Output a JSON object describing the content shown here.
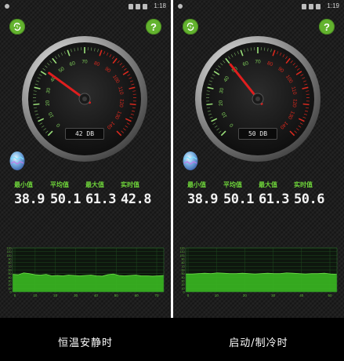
{
  "panels": [
    {
      "status_time": "1:18",
      "refresh_icon": "refresh-bolt-icon",
      "help_label": "?",
      "gauge": {
        "reading": "42 DB",
        "needle_value": 42,
        "scale_max": 140,
        "red_zone_start": 80
      },
      "stats": [
        {
          "label": "最小值",
          "value": "38.9"
        },
        {
          "label": "平均值",
          "value": "50.1"
        },
        {
          "label": "最大值",
          "value": "61.3"
        },
        {
          "label": "实时值",
          "value": "42.8"
        }
      ],
      "caption": "恒温安静时"
    },
    {
      "status_time": "1:19",
      "refresh_icon": "refresh-bolt-icon",
      "help_label": "?",
      "gauge": {
        "reading": "50 DB",
        "needle_value": 50,
        "scale_max": 140,
        "red_zone_start": 80
      },
      "stats": [
        {
          "label": "最小值",
          "value": "38.9"
        },
        {
          "label": "平均值",
          "value": "50.1"
        },
        {
          "label": "最大值",
          "value": "61.3"
        },
        {
          "label": "实时值",
          "value": "50.6"
        }
      ],
      "caption": "启动/制冷时"
    }
  ],
  "gauge_ticks": [
    "0",
    "10",
    "20",
    "30",
    "40",
    "50",
    "60",
    "70",
    "80",
    "90",
    "100",
    "110",
    "120",
    "130",
    "140"
  ],
  "colors": {
    "accent": "#63b32e",
    "label_green": "#6fd63a",
    "needle": "#e01e1e",
    "red_zone": "#d9291e",
    "chart_fill": "#38b521"
  },
  "chart_data": [
    {
      "type": "area",
      "y_ticks": [
        "120",
        "110",
        "100",
        "90",
        "80",
        "70",
        "60",
        "50",
        "40",
        "30",
        "20",
        "10",
        "0"
      ],
      "x_ticks": [
        "0",
        "10",
        "20",
        "30",
        "40",
        "50",
        "60",
        "70"
      ],
      "ylim": [
        0,
        120
      ],
      "series": [
        {
          "values": [
            48,
            47,
            52,
            50,
            47,
            46,
            48,
            44,
            45,
            44,
            46,
            45,
            44,
            45,
            46,
            44,
            43,
            47,
            49,
            45,
            44,
            45,
            46,
            44,
            44,
            43,
            44,
            45
          ]
        }
      ]
    },
    {
      "type": "area",
      "y_ticks": [
        "120",
        "110",
        "100",
        "90",
        "80",
        "70",
        "60",
        "50",
        "40",
        "30",
        "20",
        "10",
        "0"
      ],
      "x_ticks": [
        "0",
        "10",
        "20",
        "30",
        "40",
        "50"
      ],
      "ylim": [
        0,
        120
      ],
      "series": [
        {
          "values": [
            49,
            49,
            50,
            51,
            50,
            52,
            51,
            50,
            50,
            51,
            50,
            49,
            50,
            51,
            50,
            50,
            52,
            51,
            50,
            49,
            50,
            50,
            51,
            49,
            48
          ]
        }
      ]
    }
  ]
}
